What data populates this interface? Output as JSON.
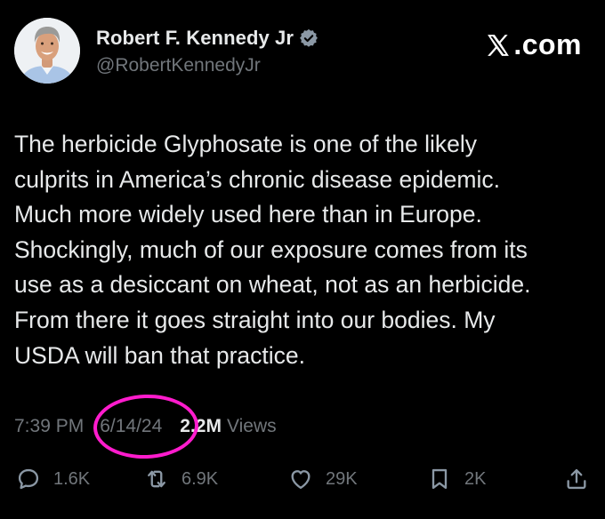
{
  "author": {
    "display_name": "Robert F. Kennedy Jr",
    "handle": "@RobertKennedyJr",
    "verified_color": "#8b98a5"
  },
  "brand": {
    "label": ".com"
  },
  "tweet": {
    "lines": [
      "The herbicide Glyphosate is one of the likely",
      "culprits in America’s chronic disease epidemic.",
      "Much more widely used here than in Europe.",
      "Shockingly, much of our exposure comes from its",
      "use as a desiccant on wheat, not as an herbicide.",
      "From there it goes straight into our bodies. My",
      "USDA will ban that practice."
    ]
  },
  "meta": {
    "time": "7:39 PM",
    "date": "6/14/24",
    "views_count": "2.2M",
    "views_label": "Views",
    "highlight_color": "#ff1ccd"
  },
  "actions": {
    "replies": "1.6K",
    "reposts": "6.9K",
    "likes": "29K",
    "bookmarks": "2K"
  }
}
